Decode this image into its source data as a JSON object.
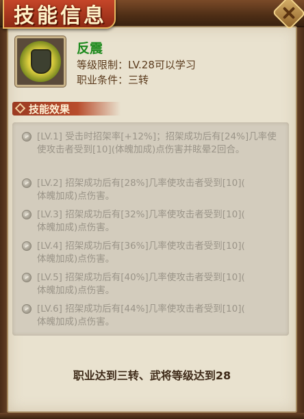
{
  "window": {
    "title": "技能信息"
  },
  "skill": {
    "icon": "shield-skill-icon",
    "name": "反震",
    "level_req": "等级限制：LV.28可以学习",
    "class_req": "职业条件：三转"
  },
  "effects_section": {
    "title": "技能效果",
    "items": [
      {
        "text": "[LV.1] 受击时招架率[+12%]；招架成功后有[24%]几率使使攻击者受到[10](体魄加成)点伤害并眩晕2回合。"
      },
      {
        "text": "[LV.2] 招架成功后有[28%]几率使攻击者受到[10](\n体魄加成)点伤害。"
      },
      {
        "text": "[LV.3] 招架成功后有[32%]几率使攻击者受到[10](\n体魄加成)点伤害。"
      },
      {
        "text": "[LV.4] 招架成功后有[36%]几率使攻击者受到[10](\n体魄加成)点伤害。"
      },
      {
        "text": "[LV.5] 招架成功后有[40%]几率使攻击者受到[10](\n体魄加成)点伤害。"
      },
      {
        "text": "[LV.6] 招架成功后有[44%]几率使攻击者受到[10](\n体魄加成)点伤害。"
      }
    ]
  },
  "requirement": "职业达到三转、武将等级达到28",
  "colors": {
    "skill_name": "#1e8a1e",
    "info_text": "#5a3a1c",
    "effect_text_locked": "#9a9488",
    "section_tab": "#b84c2c"
  }
}
